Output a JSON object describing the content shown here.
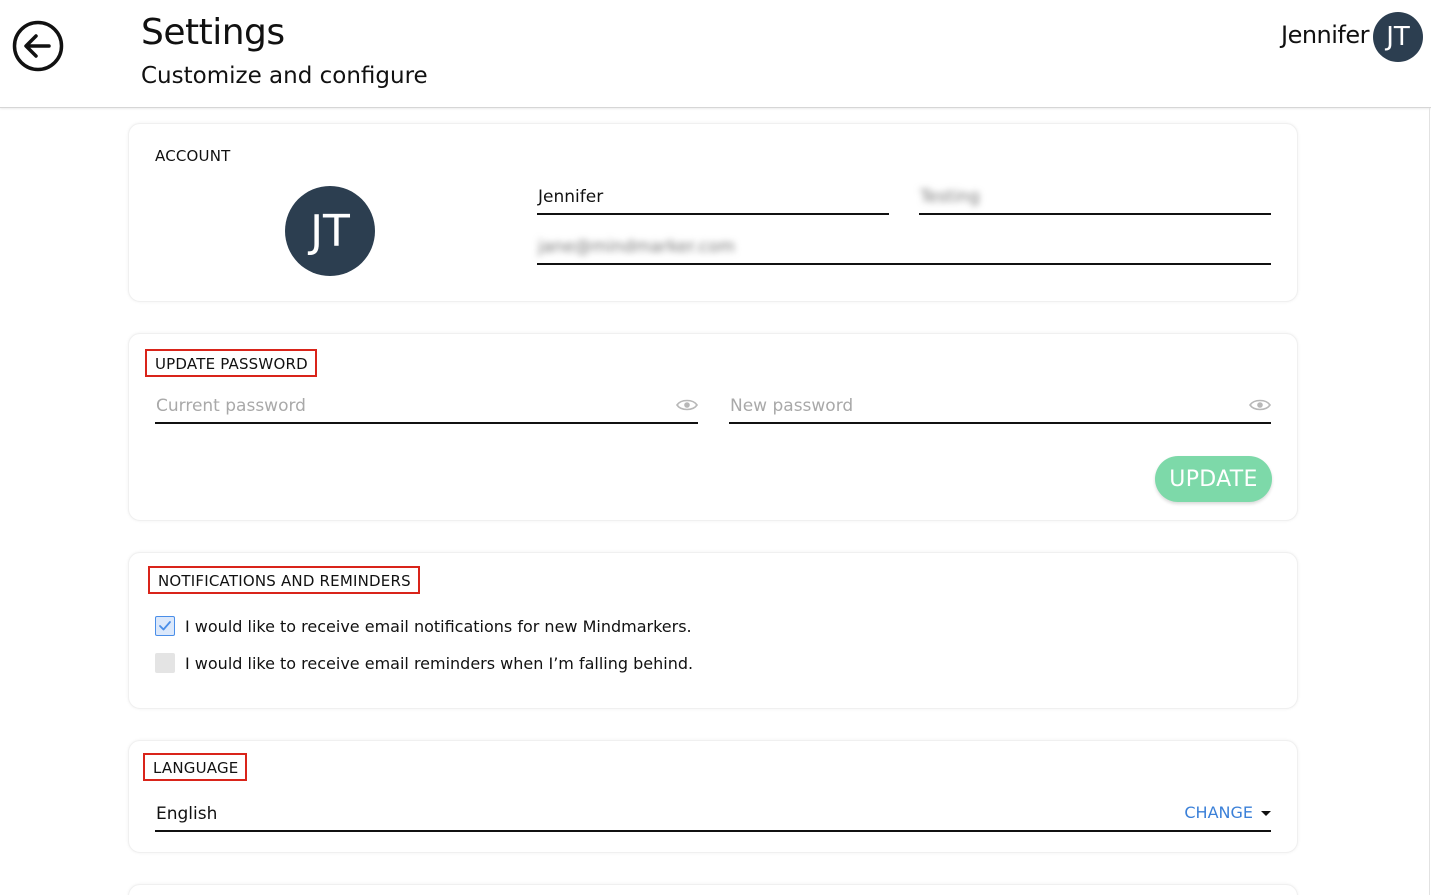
{
  "header": {
    "title": "Settings",
    "subtitle": "Customize and configure",
    "user_name": "Jennifer",
    "user_initials": "JT"
  },
  "account": {
    "label": "ACCOUNT",
    "initials": "JT",
    "first_name": "Jennifer",
    "last_name": "Testing",
    "email": "jane@mindmarker.com"
  },
  "password": {
    "label": "UPDATE PASSWORD",
    "current_placeholder": "Current password",
    "new_placeholder": "New password",
    "update_label": "UPDATE"
  },
  "notifications": {
    "label": "NOTIFICATIONS AND REMINDERS",
    "options": [
      {
        "label": "I would like to receive email notifications for new Mindmarkers.",
        "checked": true
      },
      {
        "label": "I would like to receive email reminders when I’m falling behind.",
        "checked": false
      }
    ]
  },
  "language": {
    "label": "LANGUAGE",
    "value": "English",
    "change_label": "CHANGE"
  },
  "colors": {
    "avatar": "#2c3e50",
    "highlight_box": "#d9241a",
    "update_button": "#7dd9a9",
    "link": "#3b80d8"
  }
}
